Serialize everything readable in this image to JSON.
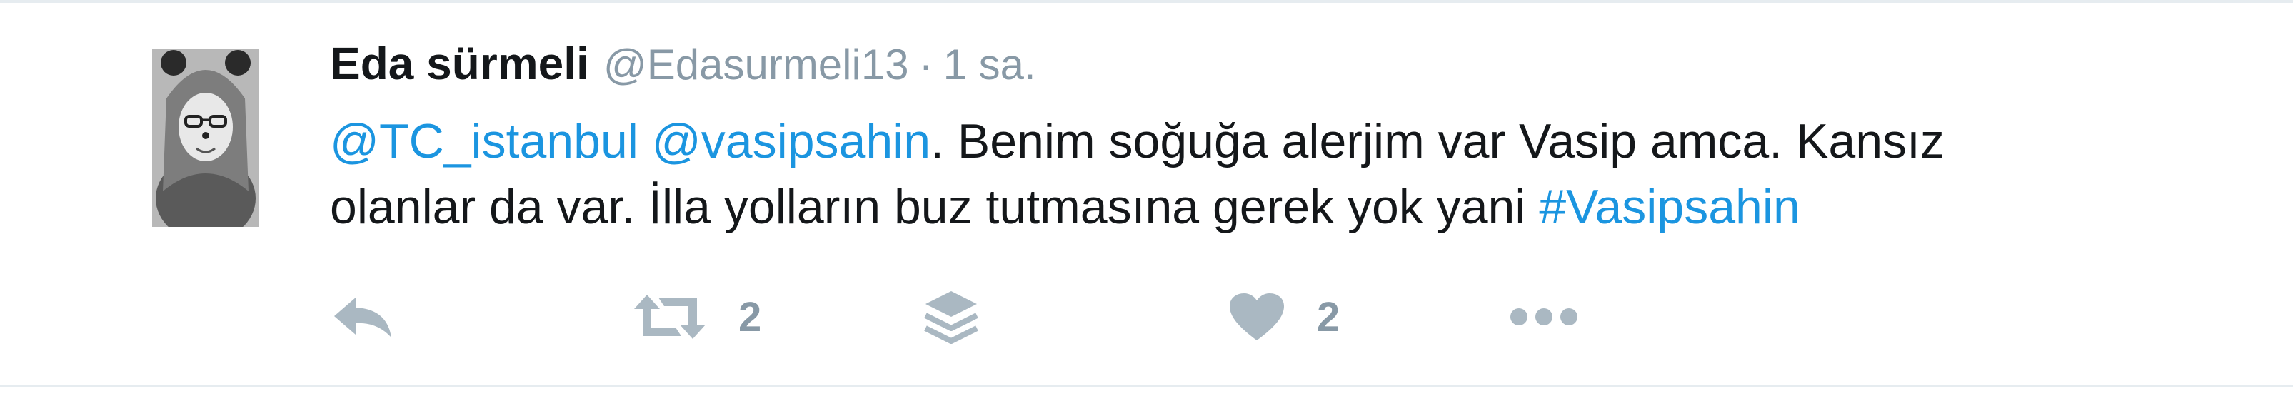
{
  "tweet": {
    "fullname": "Eda sürmeli",
    "username": "@Edasurmeli13",
    "separator": "·",
    "time": "1 sa.",
    "text": {
      "mention1": "@TC_istanbul",
      "mention2": "@vasipsahin",
      "body_line1": ". Benim soğuğa alerjim var Vasip amca. Kansız",
      "body_line2": "olanlar da var. İlla yolların buz tutmasına gerek yok yani",
      "hashtag": "#Vasipsahin"
    },
    "actions": {
      "reply_icon": "reply-icon",
      "retweet_icon": "retweet-icon",
      "retweet_count": "2",
      "layers_icon": "layers-icon",
      "like_icon": "heart-icon",
      "like_count": "2",
      "more_icon": "more-icon"
    }
  },
  "colors": {
    "link": "#1b95e0",
    "muted": "#8899a6",
    "icon": "#aab8c2",
    "text": "#14171a",
    "divider": "#e6ecf0"
  }
}
